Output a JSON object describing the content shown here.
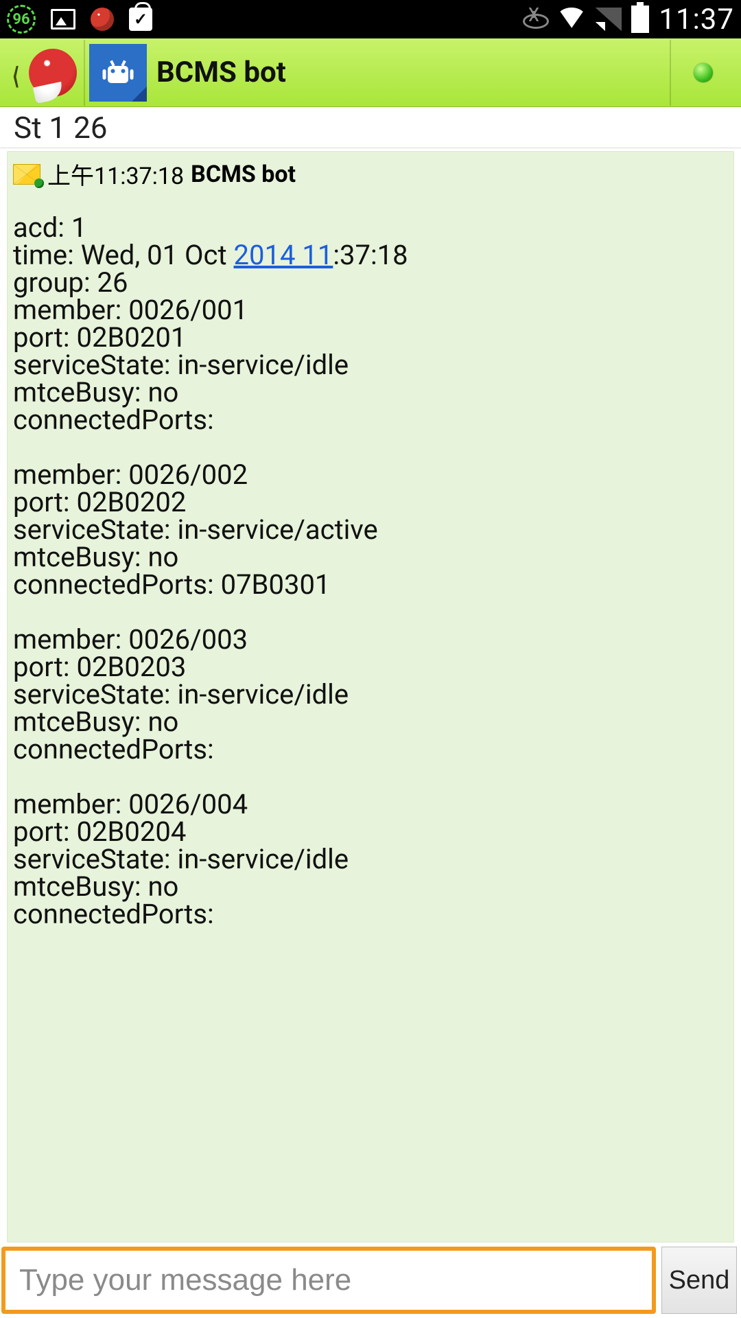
{
  "statusbar": {
    "badge_value": "96",
    "time": "11:37"
  },
  "header": {
    "title": "BCMS  bot"
  },
  "date_strip": "St 1 26",
  "message": {
    "timestamp": "上午11:37:18",
    "sender": "BCMS  bot",
    "pre_text": "acd: 1\ntime: Wed, 01 Oct ",
    "link_text": "2014 11",
    "post_link": ":37:18\ngroup: 26\nmember: 0026/001\nport: 02B0201\nserviceState: in-service/idle\nmtceBusy: no\nconnectedPorts:\n\nmember: 0026/002\nport: 02B0202\nserviceState: in-service/active\nmtceBusy: no\nconnectedPorts: 07B0301\n\nmember: 0026/003\nport: 02B0203\nserviceState: in-service/idle\nmtceBusy: no\nconnectedPorts:\n\nmember: 0026/004\nport: 02B0204\nserviceState: in-service/idle\nmtceBusy: no\nconnectedPorts:"
  },
  "input": {
    "placeholder": "Type your message here",
    "send_label": "Send"
  }
}
